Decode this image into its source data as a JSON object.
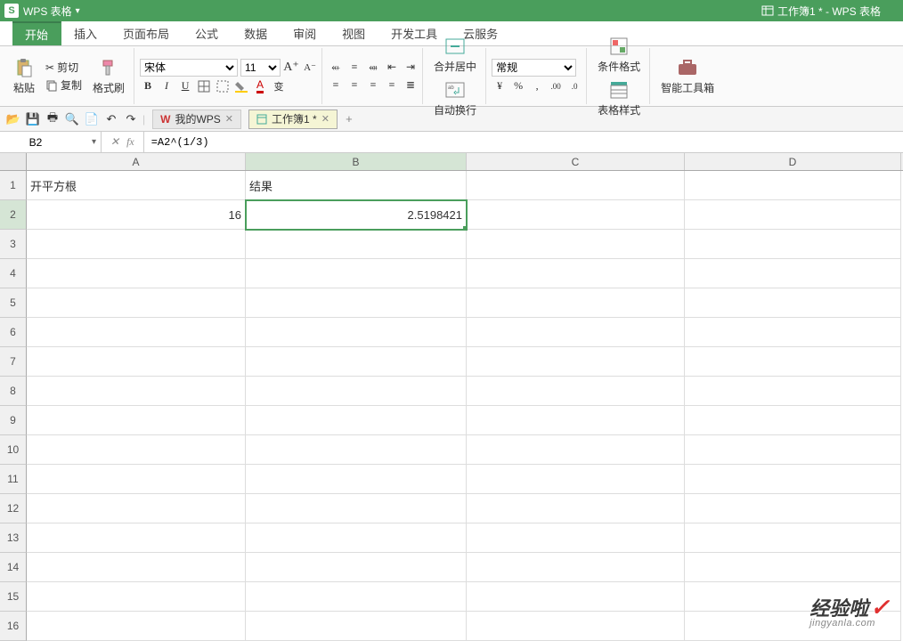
{
  "app": {
    "name": "WPS 表格",
    "window_title": "工作簿1 * - WPS 表格"
  },
  "menu": {
    "tabs": [
      "开始",
      "插入",
      "页面布局",
      "公式",
      "数据",
      "审阅",
      "视图",
      "开发工具",
      "云服务"
    ],
    "active": 0
  },
  "ribbon": {
    "paste": "粘贴",
    "cut": "剪切",
    "copy": "复制",
    "format_painter": "格式刷",
    "font_name": "宋体",
    "font_size": "11",
    "merge_center": "合并居中",
    "wrap_text": "自动换行",
    "number_format": "常规",
    "conditional_format": "条件格式",
    "table_style": "表格样式",
    "smart_toolbox": "智能工具箱"
  },
  "qat": {
    "my_wps": "我的WPS",
    "workbook_tab": "工作簿1 *"
  },
  "formula_bar": {
    "name_box": "B2",
    "formula": "=A2^(1/3)"
  },
  "columns": [
    "A",
    "B",
    "C",
    "D"
  ],
  "rows": [
    {
      "n": 1,
      "A": "开平方根",
      "B": "结果",
      "C": "",
      "D": ""
    },
    {
      "n": 2,
      "A": "16",
      "B": "2.5198421",
      "C": "",
      "D": "",
      "A_num": true,
      "B_num": true,
      "active": "B"
    },
    {
      "n": 3
    },
    {
      "n": 4
    },
    {
      "n": 5
    },
    {
      "n": 6
    },
    {
      "n": 7
    },
    {
      "n": 8
    },
    {
      "n": 9
    },
    {
      "n": 10
    },
    {
      "n": 11
    },
    {
      "n": 12
    },
    {
      "n": 13
    },
    {
      "n": 14
    },
    {
      "n": 15
    },
    {
      "n": 16
    }
  ],
  "active_cell": {
    "row": 2,
    "col": "B"
  },
  "watermark": {
    "text": "经验啦",
    "url": "jingyanla.com"
  }
}
